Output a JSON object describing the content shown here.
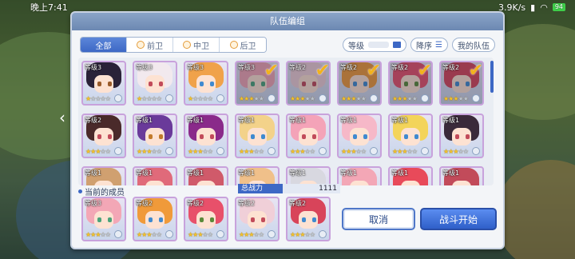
{
  "status_bar": {
    "time": "晚上7:41",
    "network_speed": "3.9K/s",
    "battery": "94"
  },
  "dialog": {
    "title": "队伍编组",
    "tabs": [
      {
        "label": "全部",
        "active": true
      },
      {
        "label": "前卫",
        "active": false
      },
      {
        "label": "中卫",
        "active": false
      },
      {
        "label": "后卫",
        "active": false
      }
    ],
    "sort_field_label": "等级",
    "order_label": "降序",
    "my_team_label": "我的队伍",
    "roster": [
      {
        "level_label": "等级3",
        "stars": 1,
        "selected": false,
        "hair": "#2a2238",
        "eye": "#9a5b2a"
      },
      {
        "level_label": "等级3",
        "stars": 1,
        "selected": false,
        "hair": "#f2e9ee",
        "eye": "#c24b5a"
      },
      {
        "level_label": "等级3",
        "stars": 1,
        "selected": false,
        "hair": "#f0a24a",
        "eye": "#3f8ad0"
      },
      {
        "level_label": "等级3",
        "stars": 3,
        "selected": true,
        "hair": "#f3a7b6",
        "eye": "#4aa37a"
      },
      {
        "level_label": "等级2",
        "stars": 3,
        "selected": true,
        "hair": "#f0cfd8",
        "eye": "#c24b5a"
      },
      {
        "level_label": "等级2",
        "stars": 3,
        "selected": true,
        "hair": "#f09a3a",
        "eye": "#3f8ad0"
      },
      {
        "level_label": "等级2",
        "stars": 3,
        "selected": true,
        "hair": "#e8506a",
        "eye": "#5a8a3a"
      },
      {
        "level_label": "等级2",
        "stars": 3,
        "selected": true,
        "hair": "#d8445a",
        "eye": "#3f8ad0"
      },
      {
        "level_label": "等级2",
        "stars": 3,
        "selected": false,
        "hair": "#4a2a2a",
        "eye": "#c24b5a"
      },
      {
        "level_label": "等级1",
        "stars": 3,
        "selected": false,
        "hair": "#6a3a9a",
        "eye": "#c27a2a"
      },
      {
        "level_label": "等级1",
        "stars": 3,
        "selected": false,
        "hair": "#8a2a8a",
        "eye": "#c24b5a"
      },
      {
        "level_label": "等级1",
        "stars": 3,
        "selected": false,
        "hair": "#f3d28a",
        "eye": "#3f8ad0"
      },
      {
        "level_label": "等级1",
        "stars": 3,
        "selected": false,
        "hair": "#f4a3b8",
        "eye": "#c24b5a"
      },
      {
        "level_label": "等级1",
        "stars": 3,
        "selected": false,
        "hair": "#f6b8c8",
        "eye": "#3f8ad0"
      },
      {
        "level_label": "等级1",
        "stars": 3,
        "selected": false,
        "hair": "#f3d45a",
        "eye": "#3f8ad0"
      },
      {
        "level_label": "等级1",
        "stars": 3,
        "selected": false,
        "hair": "#3a2a3a",
        "eye": "#c24b5a"
      },
      {
        "level_label": "等级1",
        "stars": 0,
        "selected": false,
        "hair": "#d0a070",
        "eye": "#3f8ad0"
      },
      {
        "level_label": "等级1",
        "stars": 0,
        "selected": false,
        "hair": "#e06a7a",
        "eye": "#3f8ad0"
      },
      {
        "level_label": "等级1",
        "stars": 0,
        "selected": false,
        "hair": "#d05a6a",
        "eye": "#3f8ad0"
      },
      {
        "level_label": "等级1",
        "stars": 0,
        "selected": false,
        "hair": "#f0c08a",
        "eye": "#3f8ad0"
      },
      {
        "level_label": "等级1",
        "stars": 0,
        "selected": false,
        "hair": "#d8d8e0",
        "eye": "#3f8ad0"
      },
      {
        "level_label": "等级1",
        "stars": 0,
        "selected": false,
        "hair": "#f3a7b6",
        "eye": "#3f8ad0"
      },
      {
        "level_label": "等级1",
        "stars": 0,
        "selected": false,
        "hair": "#e84a5a",
        "eye": "#3f8ad0"
      },
      {
        "level_label": "等级1",
        "stars": 0,
        "selected": false,
        "hair": "#c24b5a",
        "eye": "#3f8ad0"
      }
    ],
    "current_members_label": "当前的成员",
    "total_power_label": "总战力",
    "total_power_value": "1111",
    "members": [
      {
        "level_label": "等级3",
        "stars": 3,
        "hair": "#f3a7b6",
        "eye": "#4aa37a"
      },
      {
        "level_label": "等级2",
        "stars": 3,
        "hair": "#f09a3a",
        "eye": "#3f8ad0"
      },
      {
        "level_label": "等级2",
        "stars": 3,
        "hair": "#e8506a",
        "eye": "#5a8a3a"
      },
      {
        "level_label": "等级2",
        "stars": 3,
        "hair": "#f0cfd8",
        "eye": "#c24b5a"
      },
      {
        "level_label": "等级2",
        "stars": 3,
        "hair": "#d8445a",
        "eye": "#3f8ad0"
      }
    ],
    "cancel_label": "取消",
    "start_label": "战斗开始"
  }
}
